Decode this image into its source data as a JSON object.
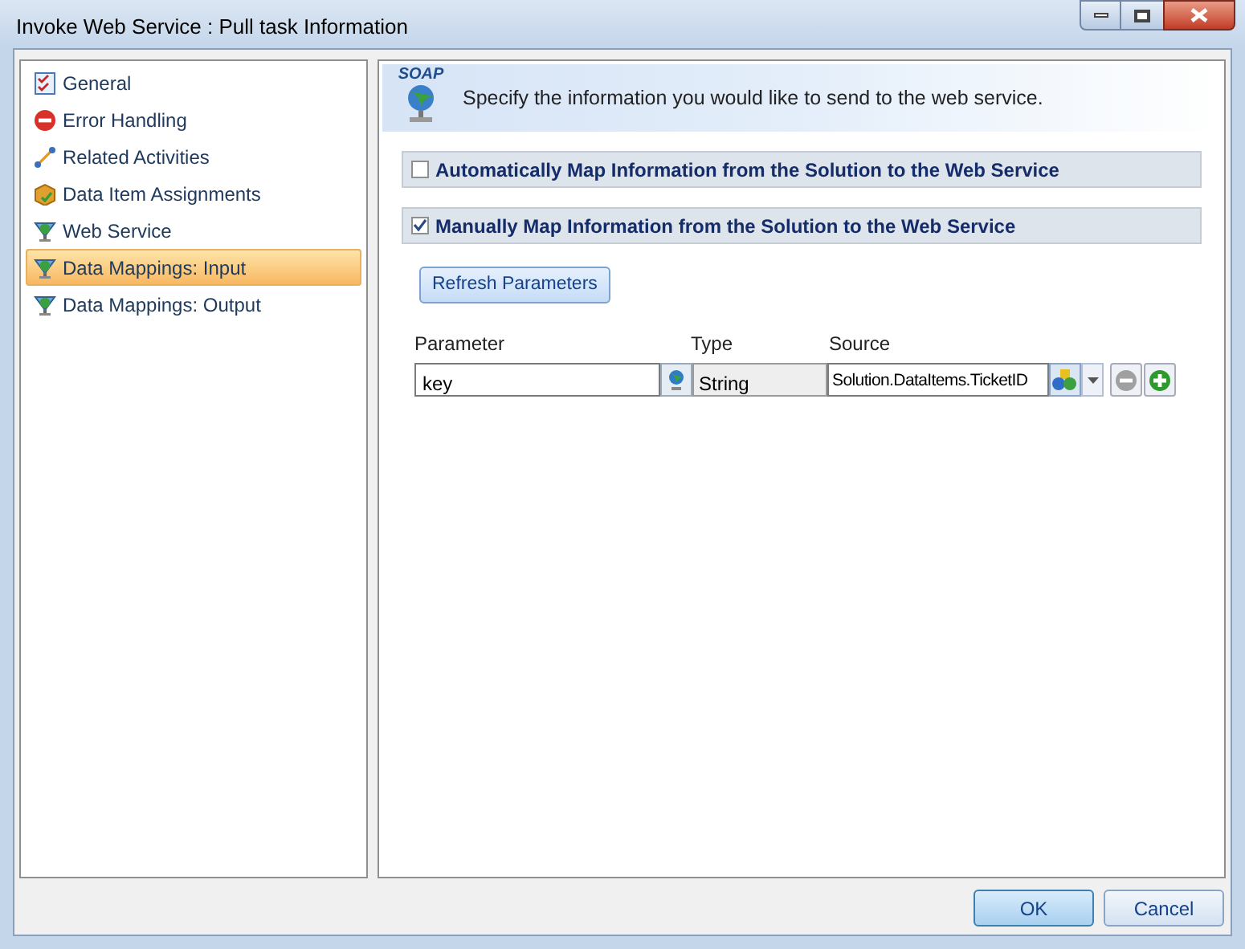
{
  "window": {
    "title": "Invoke Web Service : Pull task Information"
  },
  "sidebar": {
    "items": [
      {
        "label": "General",
        "kind": "checklist",
        "selected": false
      },
      {
        "label": "Error Handling",
        "kind": "stop",
        "selected": false
      },
      {
        "label": "Related Activities",
        "kind": "link",
        "selected": false
      },
      {
        "label": "Data Item Assignments",
        "kind": "box",
        "selected": false
      },
      {
        "label": "Web Service",
        "kind": "soap",
        "selected": false
      },
      {
        "label": "Data Mappings: Input",
        "kind": "soap",
        "selected": true
      },
      {
        "label": "Data Mappings: Output",
        "kind": "soap",
        "selected": false
      }
    ]
  },
  "header": {
    "badge": "SOAP",
    "text": "Specify the information you would like to send to the web service."
  },
  "options": [
    {
      "label": "Automatically Map Information from the Solution to the Web Service",
      "checked": false
    },
    {
      "label": "Manually Map Information from the Solution to the Web Service",
      "checked": true
    }
  ],
  "refresh_button": "Refresh Parameters",
  "table": {
    "columns": [
      "Parameter",
      "Type",
      "Source"
    ],
    "rows": [
      {
        "parameter": "key",
        "type": "String",
        "source": "Solution.DataItems.TicketID"
      }
    ]
  },
  "buttons": [
    {
      "label": "OK",
      "default": true
    },
    {
      "label": "Cancel",
      "default": false
    }
  ]
}
